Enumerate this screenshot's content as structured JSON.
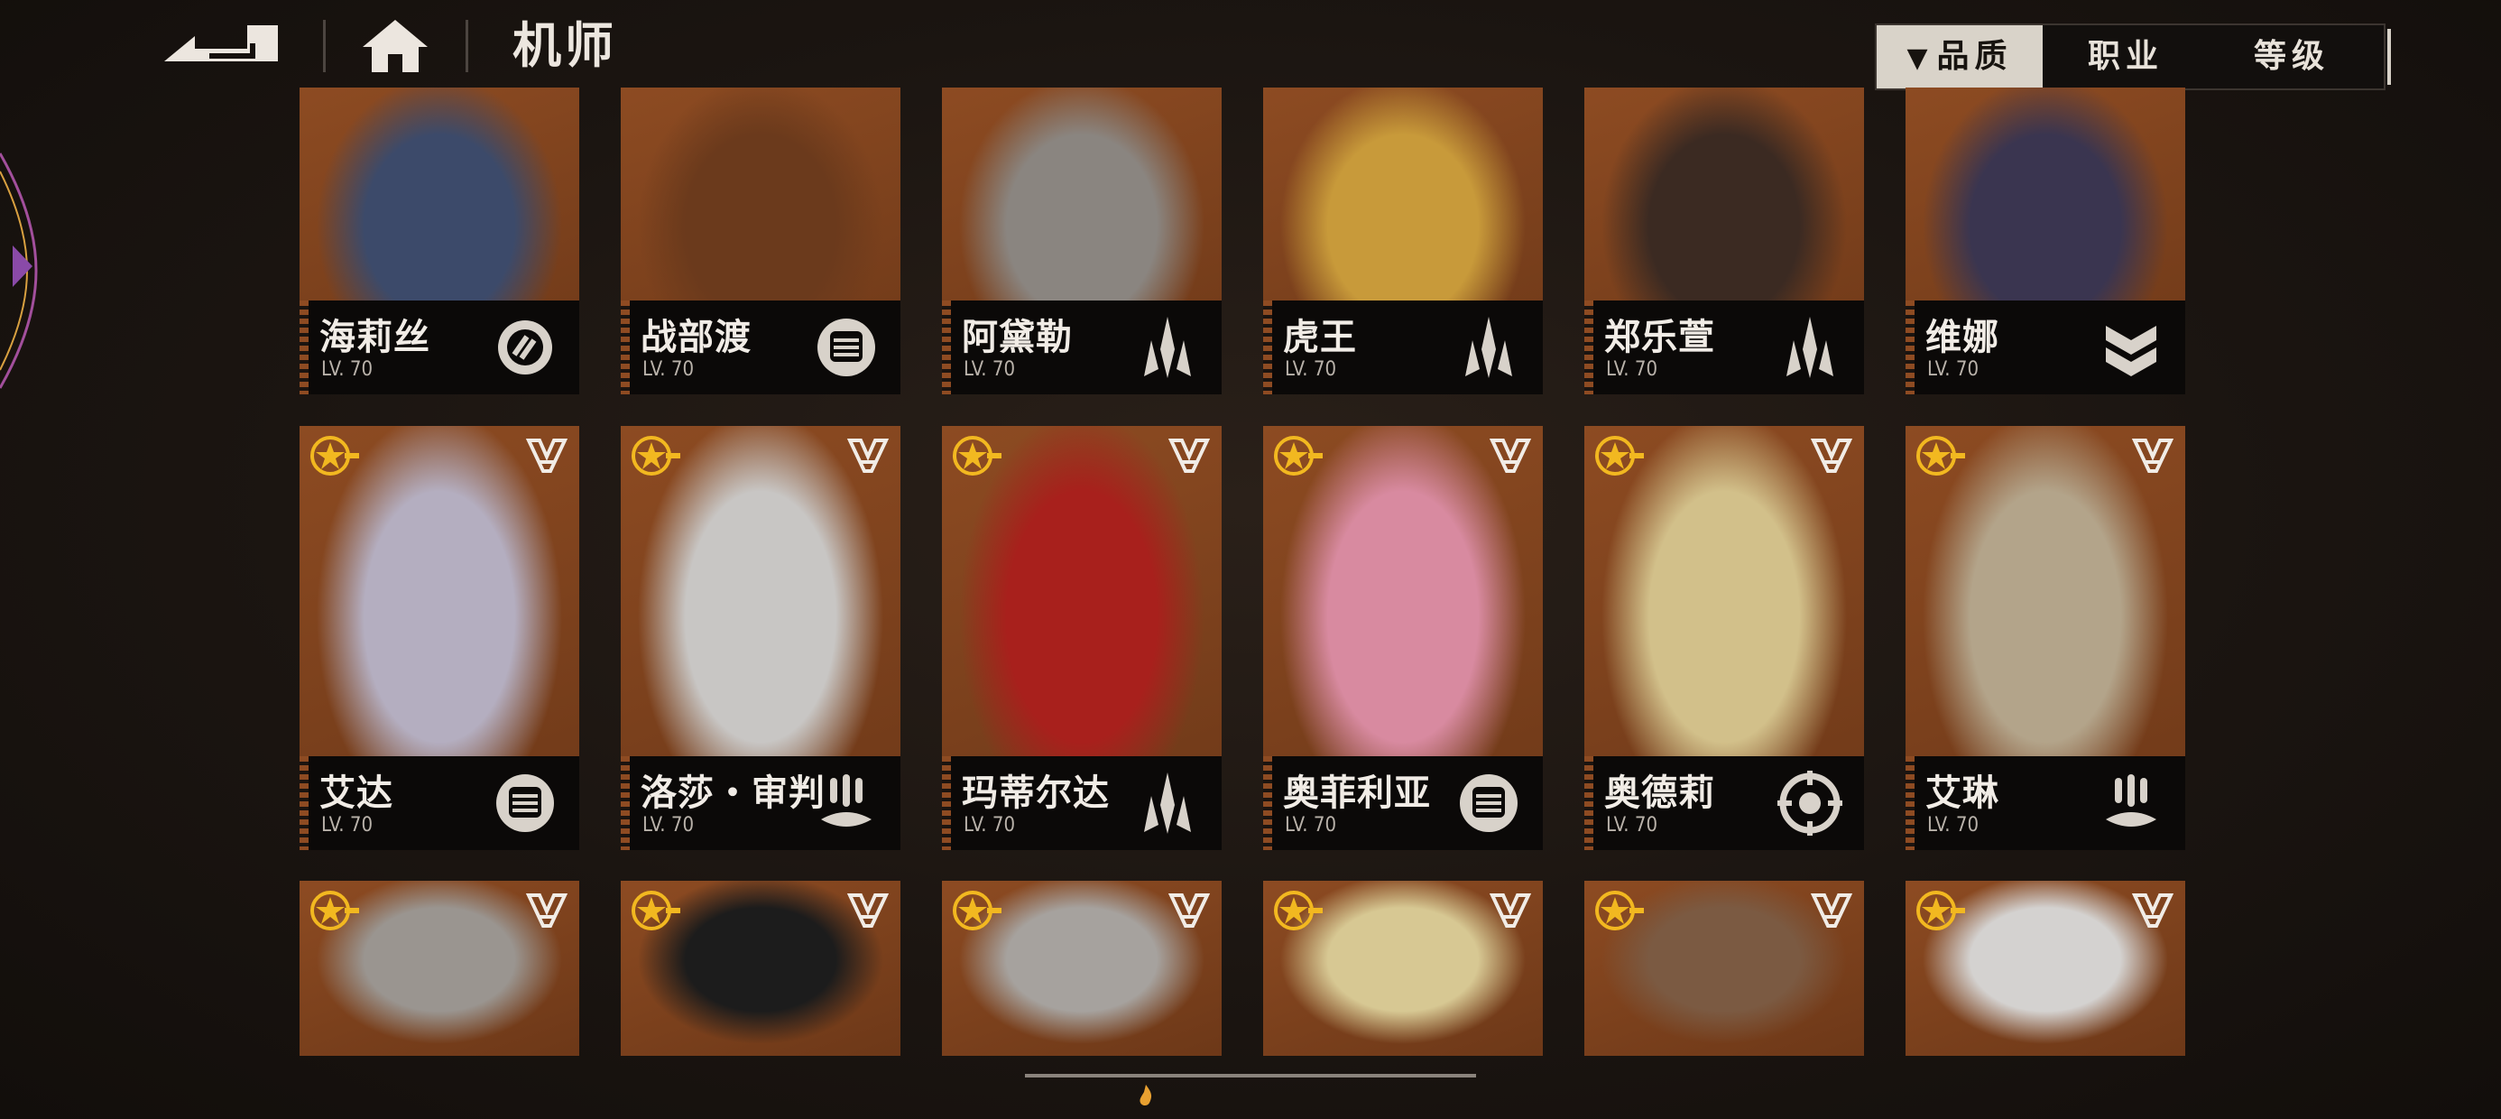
{
  "header": {
    "title": "机师",
    "back_icon": "back-arrow-icon",
    "home_icon": "home-icon"
  },
  "sort_tabs": [
    {
      "label": "品质",
      "active": true,
      "indicator": "chevron-down-icon"
    },
    {
      "label": "职业",
      "active": false
    },
    {
      "label": "等级",
      "active": false
    }
  ],
  "rows": [
    {
      "cards": [
        {
          "name": "海莉丝",
          "level": "LV. 70",
          "class_icon": "gauge-class-icon",
          "art_hue": "#3c4a6a"
        },
        {
          "name": "战部渡",
          "level": "LV. 70",
          "class_icon": "fist-class-icon",
          "art_hue": "#6b3a1c"
        },
        {
          "name": "阿黛勒",
          "level": "LV. 70",
          "class_icon": "blade-class-icon",
          "art_hue": "#8a8580"
        },
        {
          "name": "虎王",
          "level": "LV. 70",
          "class_icon": "blade-class-icon",
          "art_hue": "#c89a3a"
        },
        {
          "name": "郑乐萱",
          "level": "LV. 70",
          "class_icon": "blade-class-icon",
          "art_hue": "#3b2a22"
        },
        {
          "name": "维娜",
          "level": "LV. 70",
          "class_icon": "chevron-rank-class-icon",
          "art_hue": "#3a3550"
        }
      ]
    },
    {
      "cards": [
        {
          "name": "艾达",
          "level": "LV. 70",
          "class_icon": "fist-class-icon",
          "art_hue": "#b4aec0"
        },
        {
          "name": "洛莎・审判",
          "level": "LV. 70",
          "class_icon": "missile-class-icon",
          "art_hue": "#c8c6c4"
        },
        {
          "name": "玛蒂尔达",
          "level": "LV. 70",
          "class_icon": "blade-class-icon",
          "art_hue": "#a8201c"
        },
        {
          "name": "奥菲利亚",
          "level": "LV. 70",
          "class_icon": "fist-class-icon",
          "art_hue": "#d88aa0"
        },
        {
          "name": "奥德莉",
          "level": "LV. 70",
          "class_icon": "target-class-icon",
          "art_hue": "#d2c08a"
        },
        {
          "name": "艾琳",
          "level": "LV. 70",
          "class_icon": "missile-class-icon",
          "art_hue": "#b3a48a"
        }
      ]
    },
    {
      "cards": [
        {
          "art_hue": "#9a9590"
        },
        {
          "art_hue": "#1c1c1c"
        },
        {
          "art_hue": "#a6a29e"
        },
        {
          "art_hue": "#d7c893"
        },
        {
          "art_hue": "#7b5a42"
        },
        {
          "art_hue": "#d4d2d0"
        }
      ]
    }
  ],
  "colors": {
    "card_bg": "#7a4320",
    "nameplate": "#0b0908",
    "star_gold": "#f2b820",
    "accent_light": "#d9d3c9"
  }
}
